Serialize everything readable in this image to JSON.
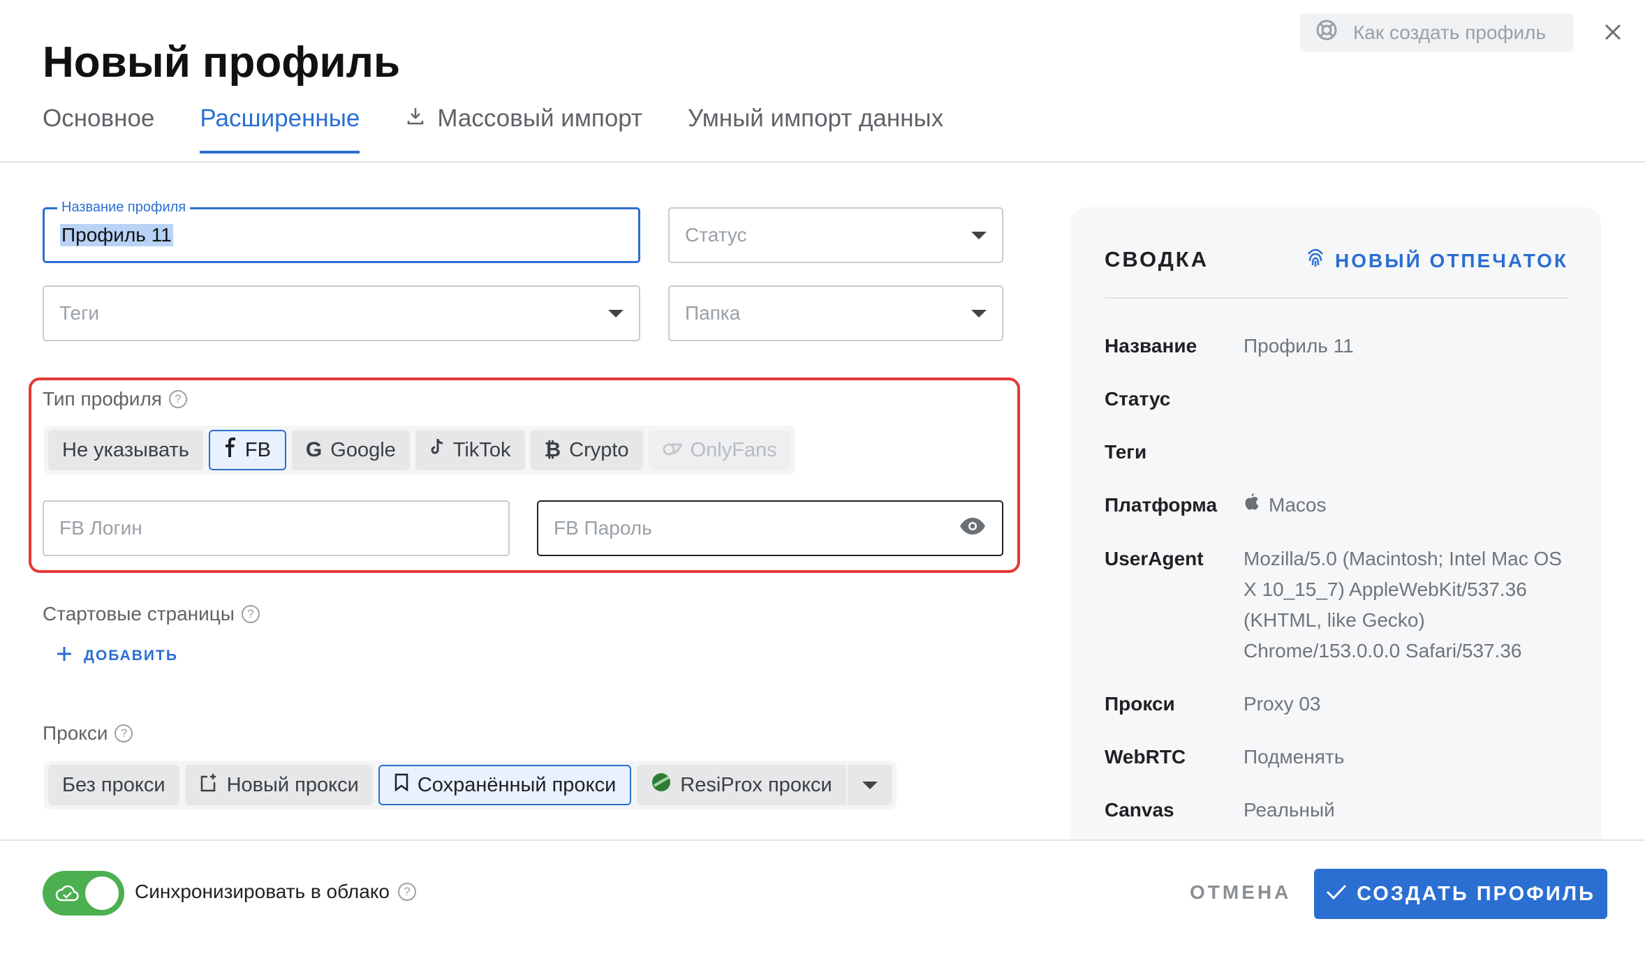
{
  "title": "Новый профиль",
  "help_button_label": "Как создать профиль",
  "tabs": [
    {
      "label": "Основное"
    },
    {
      "label": "Расширенные"
    },
    {
      "label": "Массовый импорт"
    },
    {
      "label": "Умный импорт данных"
    }
  ],
  "form": {
    "name_label": "Название профиля",
    "name_value": "Профиль 11",
    "status_placeholder": "Статус",
    "tags_placeholder": "Теги",
    "folder_placeholder": "Папка"
  },
  "profile_type": {
    "label": "Тип профиля",
    "options": [
      "Не указывать",
      "FB",
      "Google",
      "TikTok",
      "Crypto",
      "OnlyFans"
    ],
    "selected": "FB",
    "login_placeholder": "FB Логин",
    "password_placeholder": "FB Пароль"
  },
  "start_pages": {
    "label": "Стартовые страницы",
    "add_label": "ДОБАВИТЬ"
  },
  "proxy": {
    "label": "Прокси",
    "options": [
      "Без прокси",
      "Новый прокси",
      "Сохранённый прокси",
      "ResiProx прокси"
    ],
    "selected": "Сохранённый прокси"
  },
  "summary": {
    "title": "СВОДКА",
    "new_fingerprint": "НОВЫЙ ОТПЕЧАТОК",
    "rows": [
      {
        "key": "Название",
        "value": "Профиль 11"
      },
      {
        "key": "Статус",
        "value": ""
      },
      {
        "key": "Теги",
        "value": ""
      },
      {
        "key": "Платформа",
        "value": "Macos"
      },
      {
        "key": "UserAgent",
        "value": "Mozilla/5.0 (Macintosh; Intel Mac OS X 10_15_7) AppleWebKit/537.36 (KHTML, like Gecko) Chrome/153.0.0.0 Safari/537.36"
      },
      {
        "key": "Прокси",
        "value": "Proxy 03"
      },
      {
        "key": "WebRTC",
        "value": "Подменять"
      },
      {
        "key": "Canvas",
        "value": "Реальный"
      }
    ]
  },
  "footer": {
    "sync_label": "Синхронизировать в облако",
    "sync_enabled": true,
    "cancel_label": "ОТМЕНА",
    "create_label": "СОЗДАТЬ ПРОФИЛЬ"
  },
  "colors": {
    "accent": "#2a6fd1",
    "highlight_border": "#e53935",
    "toggle_on": "#4caf50"
  }
}
